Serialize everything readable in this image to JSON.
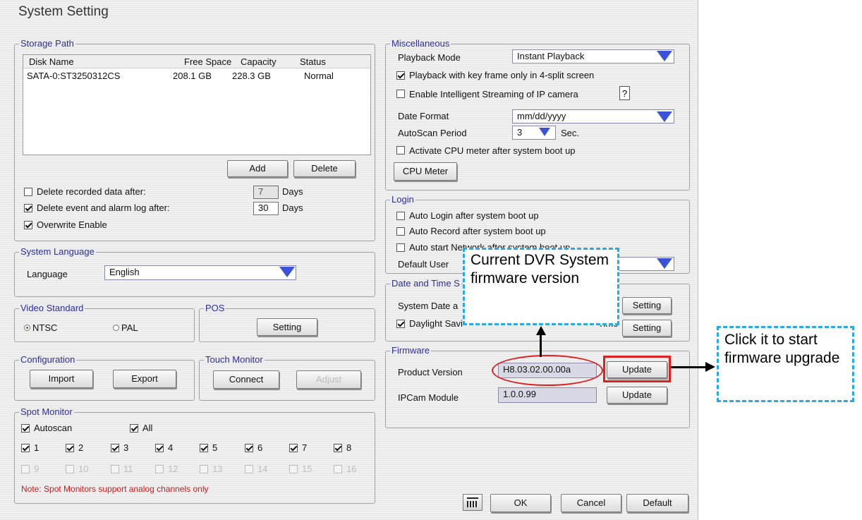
{
  "window": {
    "title": "System Setting"
  },
  "storage": {
    "legend": "Storage Path",
    "columns": [
      "Disk Name",
      "Free Space",
      "Capacity",
      "Status"
    ],
    "rows": [
      [
        "SATA-0:ST3250312CS",
        "208.1 GB",
        "228.3 GB",
        "Normal"
      ]
    ],
    "add_label": "Add",
    "delete_label": "Delete",
    "delete_recorded_label": "Delete recorded data after:",
    "delete_recorded_days": "7",
    "delete_event_label": "Delete event and alarm log after:",
    "delete_event_days": "30",
    "days_label": "Days",
    "overwrite_label": "Overwrite Enable"
  },
  "language": {
    "legend": "System Language",
    "label": "Language",
    "value": "English"
  },
  "video": {
    "legend": "Video Standard",
    "ntsc": "NTSC",
    "pal": "PAL"
  },
  "pos": {
    "legend": "POS",
    "setting_label": "Setting"
  },
  "config": {
    "legend": "Configuration",
    "import_label": "Import",
    "export_label": "Export"
  },
  "touch": {
    "legend": "Touch Monitor",
    "connect_label": "Connect",
    "adjust_label": "Adjust"
  },
  "spot": {
    "legend": "Spot Monitor",
    "autoscan_label": "Autoscan",
    "all_label": "All",
    "row1": [
      "1",
      "2",
      "3",
      "4",
      "5",
      "6",
      "7",
      "8"
    ],
    "row2": [
      "9",
      "10",
      "11",
      "12",
      "13",
      "14",
      "15",
      "16"
    ],
    "note": "Note: Spot Monitors support analog channels only"
  },
  "misc": {
    "legend": "Miscellaneous",
    "playback_mode_label": "Playback Mode",
    "playback_mode_value": "Instant Playback",
    "keyframe_label": "Playback with key frame only in 4-split screen",
    "intelligent_label": "Enable Intelligent Streaming of IP camera",
    "help_label": "?",
    "date_format_label": "Date Format",
    "date_format_value": "mm/dd/yyyy",
    "autoscan_label": "AutoScan Period",
    "autoscan_value": "3",
    "sec_label": "Sec.",
    "cpu_activate_label": "Activate CPU meter after system boot up",
    "cpu_meter_label": "CPU Meter"
  },
  "login": {
    "legend": "Login",
    "auto_login_label": "Auto Login after system boot up",
    "auto_record_label": "Auto Record after system boot up",
    "auto_network_label": "Auto start Network after system boot up",
    "default_user_label": "Default User"
  },
  "datetime": {
    "legend": "Date and Time S",
    "system_date_label": "System Date a",
    "daylight_label": "Daylight Savi",
    "daylight_tail": "Time",
    "setting_label": "Setting"
  },
  "firmware": {
    "legend": "Firmware",
    "product_label": "Product Version",
    "product_value": "H8.03.02.00.00a",
    "ipcam_label": "IPCam Module",
    "ipcam_value": "1.0.0.99",
    "update_label": "Update"
  },
  "footer": {
    "ok_label": "OK",
    "cancel_label": "Cancel",
    "default_label": "Default"
  },
  "annotations": {
    "version_callout": "Current DVR System firmware version",
    "update_callout": "Click it to start firmware upgrade"
  }
}
